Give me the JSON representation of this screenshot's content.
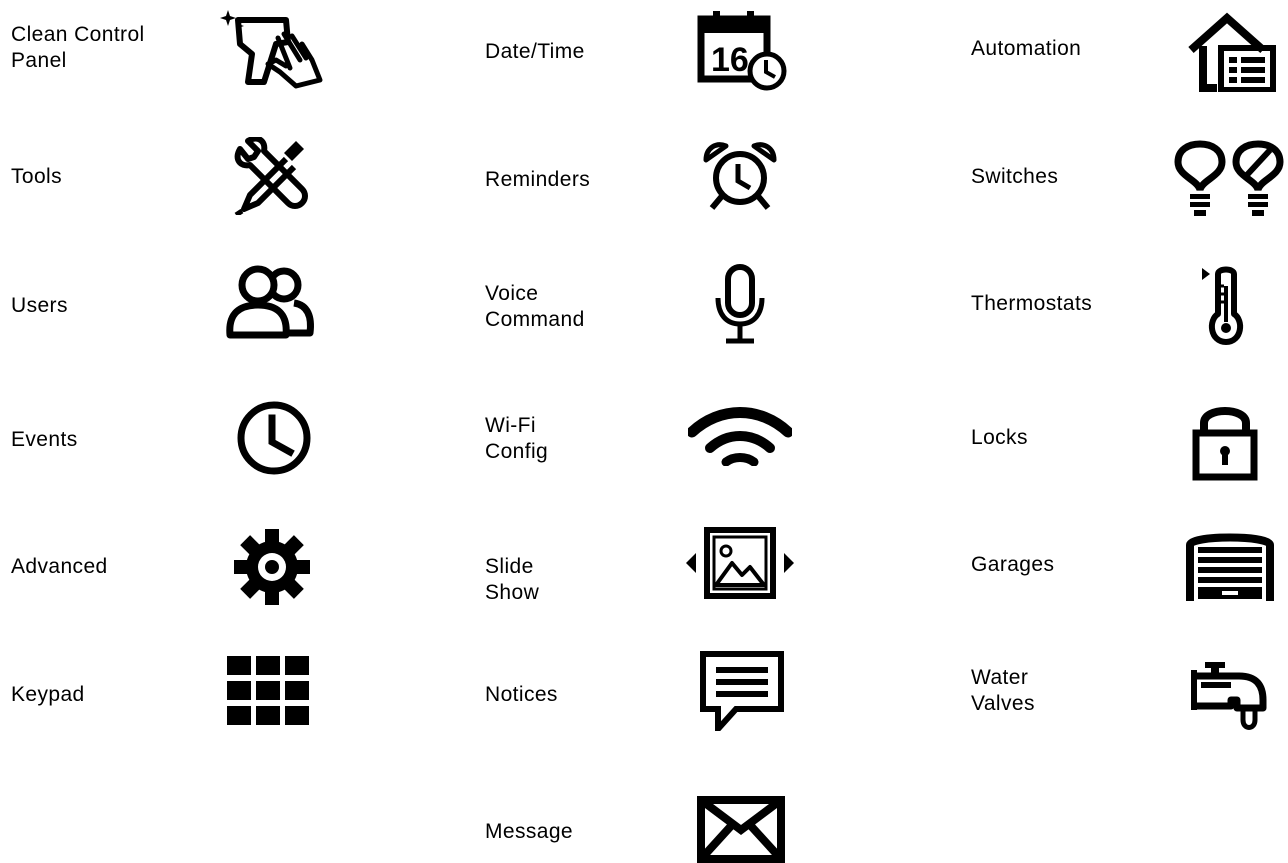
{
  "column1": {
    "items": [
      {
        "label": "Clean Control\nPanel",
        "icon": "clean-hand-icon"
      },
      {
        "label": "Tools",
        "icon": "tools-icon"
      },
      {
        "label": "Users",
        "icon": "users-icon"
      },
      {
        "label": "Events",
        "icon": "clock-icon"
      },
      {
        "label": "Advanced",
        "icon": "gear-icon"
      },
      {
        "label": "Keypad",
        "icon": "keypad-grid-icon"
      }
    ]
  },
  "column2": {
    "items": [
      {
        "label": "Date/Time",
        "icon": "calendar-clock-icon",
        "icon_text": "16"
      },
      {
        "label": "Reminders",
        "icon": "alarm-clock-icon"
      },
      {
        "label": "Voice\nCommand",
        "icon": "microphone-icon"
      },
      {
        "label": "Wi-Fi\nConfig",
        "icon": "wifi-icon"
      },
      {
        "label": "Slide Show",
        "icon": "slideshow-icon"
      },
      {
        "label": "Notices",
        "icon": "notice-icon"
      },
      {
        "label": "Message",
        "icon": "envelope-icon"
      }
    ]
  },
  "column3": {
    "items": [
      {
        "label": "Automation",
        "icon": "home-automation-icon"
      },
      {
        "label": "Switches",
        "icon": "lightbulbs-icon"
      },
      {
        "label": "Thermostats",
        "icon": "thermometer-icon"
      },
      {
        "label": "Locks",
        "icon": "padlock-icon"
      },
      {
        "label": "Garages",
        "icon": "garage-door-icon"
      },
      {
        "label": "Water\nValves",
        "icon": "water-valve-icon"
      }
    ]
  }
}
